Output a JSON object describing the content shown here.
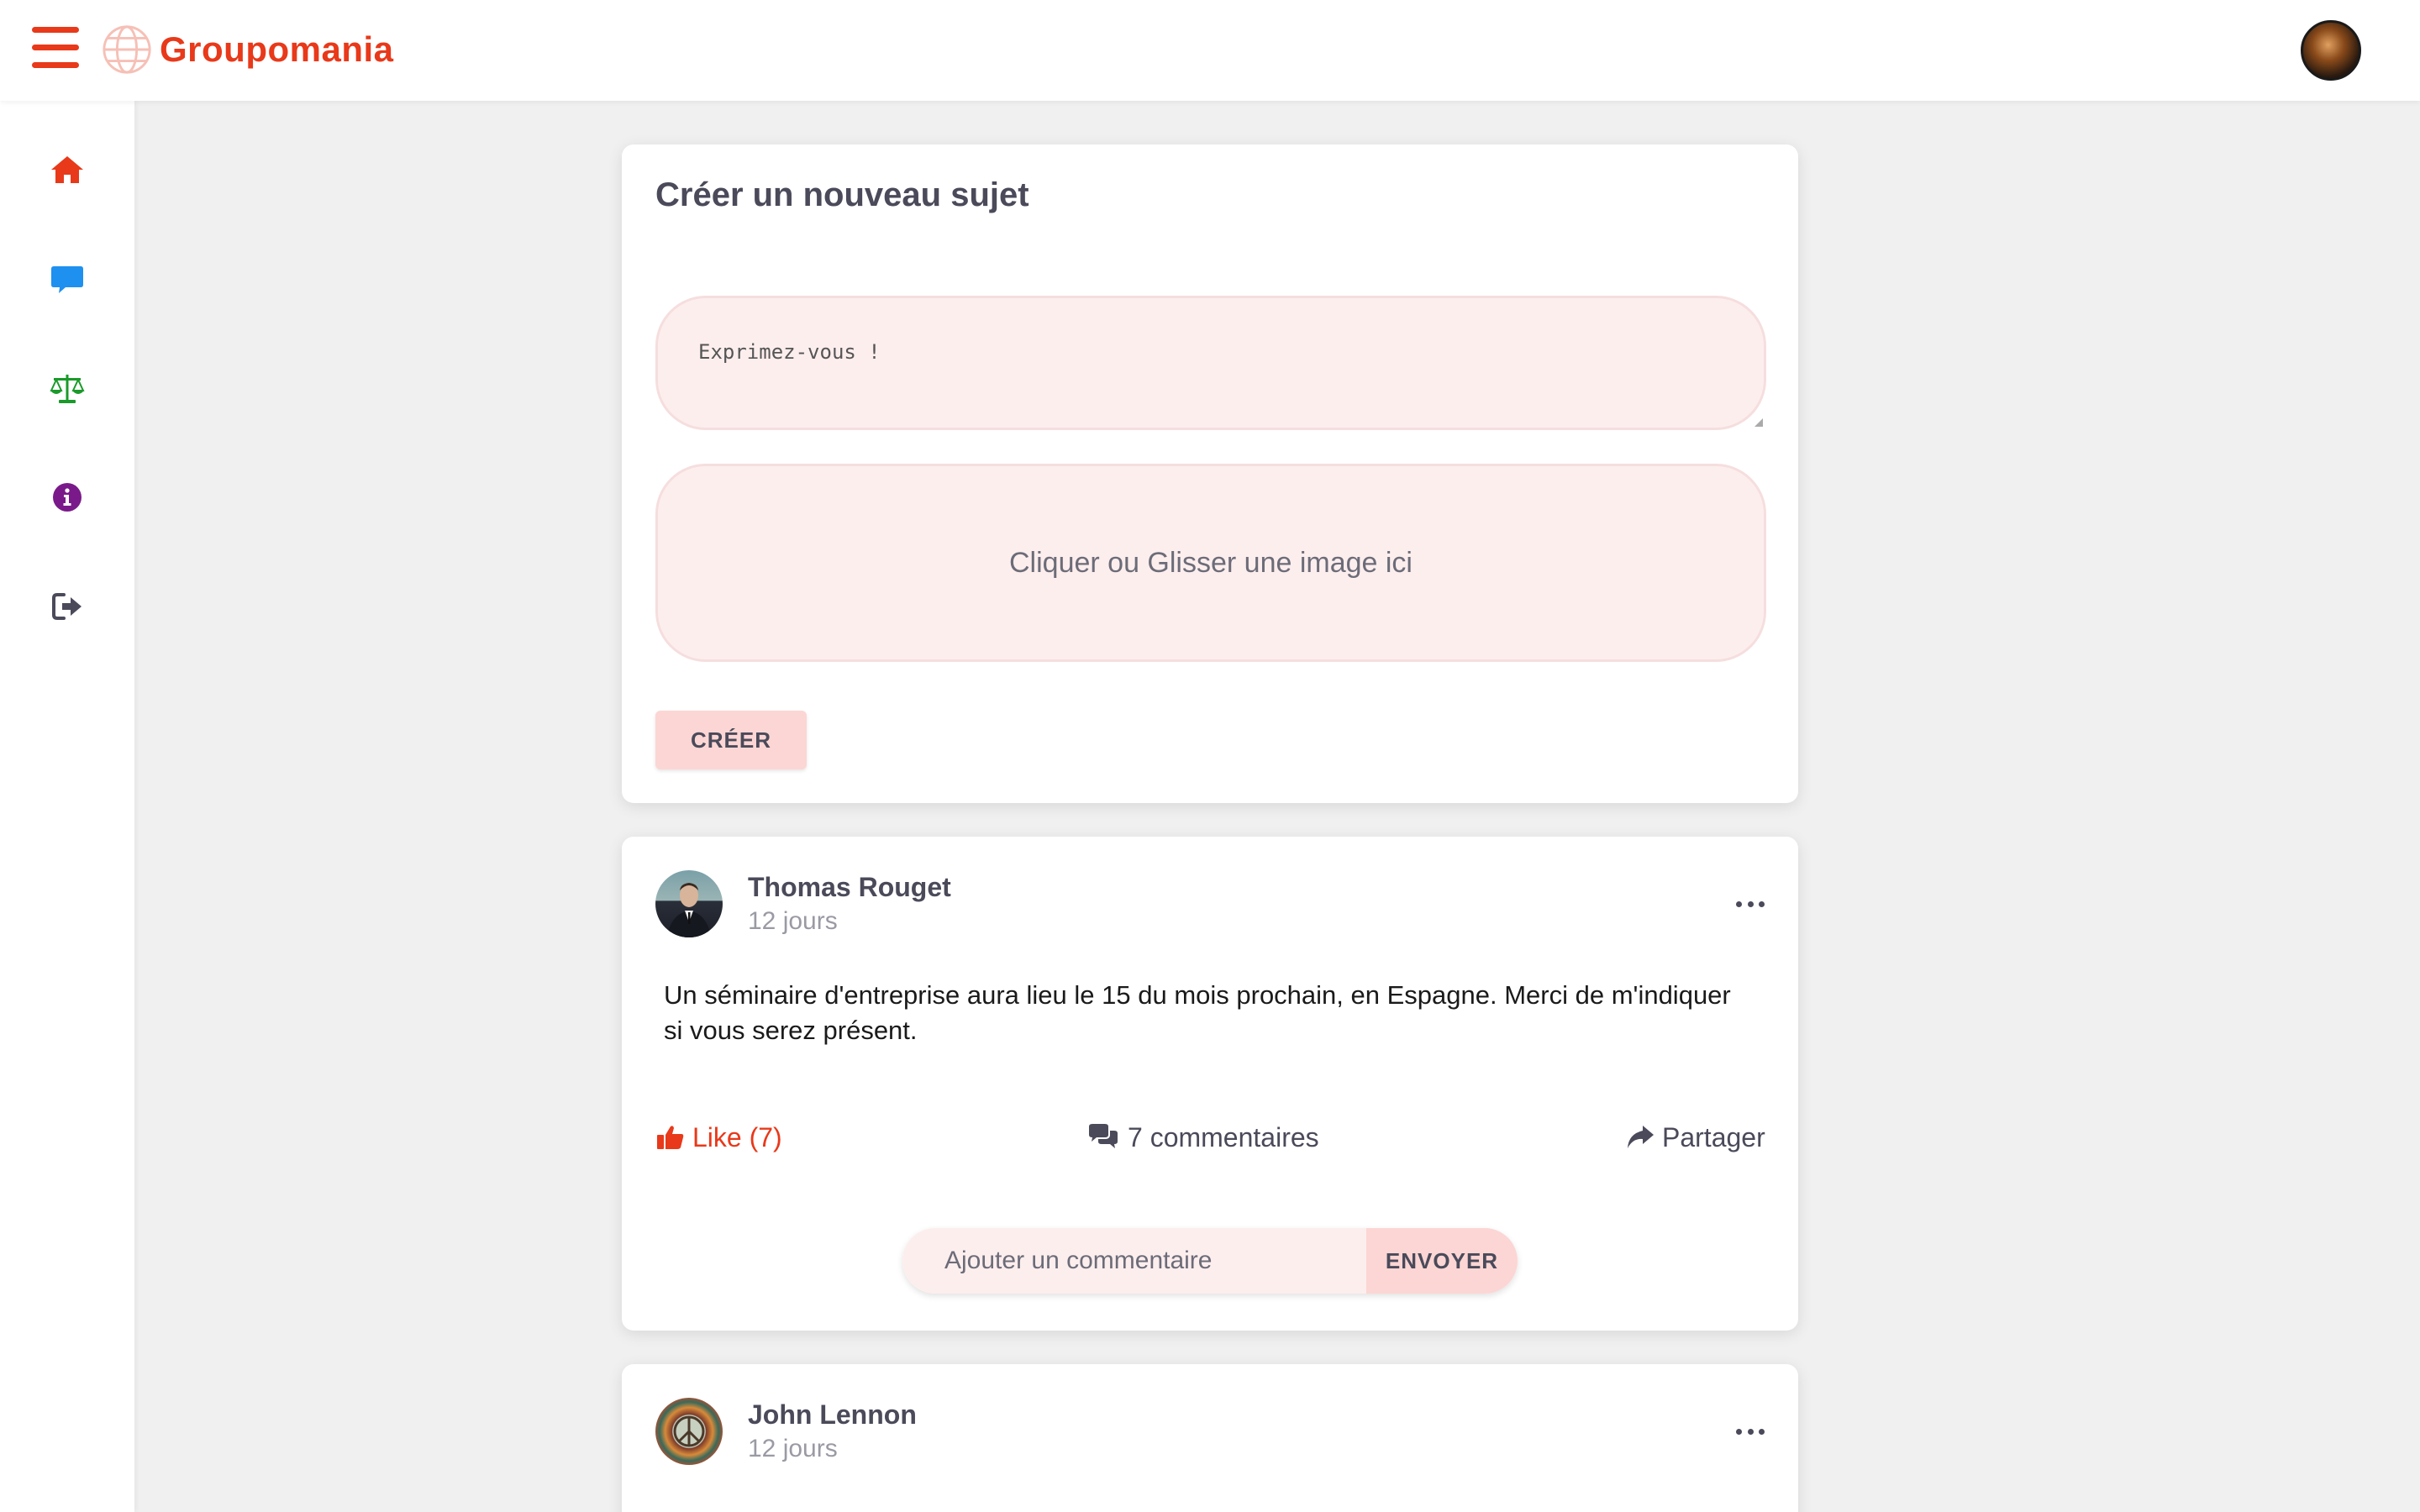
{
  "app": {
    "name": "Groupomania",
    "brand_color": "#e8391a"
  },
  "header": {
    "menu_icon": "hamburger-icon",
    "logo_icon": "globe-icon",
    "avatar": "user-avatar"
  },
  "sidebar": {
    "items": [
      {
        "icon": "home-icon",
        "color": "#e8391a"
      },
      {
        "icon": "comment-icon",
        "color": "#1e90f0"
      },
      {
        "icon": "balance-scale-icon",
        "color": "#1a9a2a"
      },
      {
        "icon": "info-icon",
        "color": "#7a1a8a"
      },
      {
        "icon": "sign-out-icon",
        "color": "#4a4a5a"
      }
    ]
  },
  "create": {
    "title": "Créer un nouveau sujet",
    "text_placeholder": "Exprimez-vous !",
    "dropzone_label": "Cliquer ou Glisser une image ici",
    "submit_label": "CRÉER"
  },
  "posts": [
    {
      "author": "Thomas Rouget",
      "time": "12 jours",
      "text": "Un séminaire d'entreprise aura lieu le 15 du mois prochain, en Espagne. Merci de m'indiquer si vous serez présent.",
      "like_label": "Like (7)",
      "comments_label": "7 commentaires",
      "share_label": "Partager",
      "comment_placeholder": "Ajouter un commentaire",
      "send_label": "ENVOYER"
    },
    {
      "author": "John Lennon",
      "time": "12 jours"
    }
  ]
}
